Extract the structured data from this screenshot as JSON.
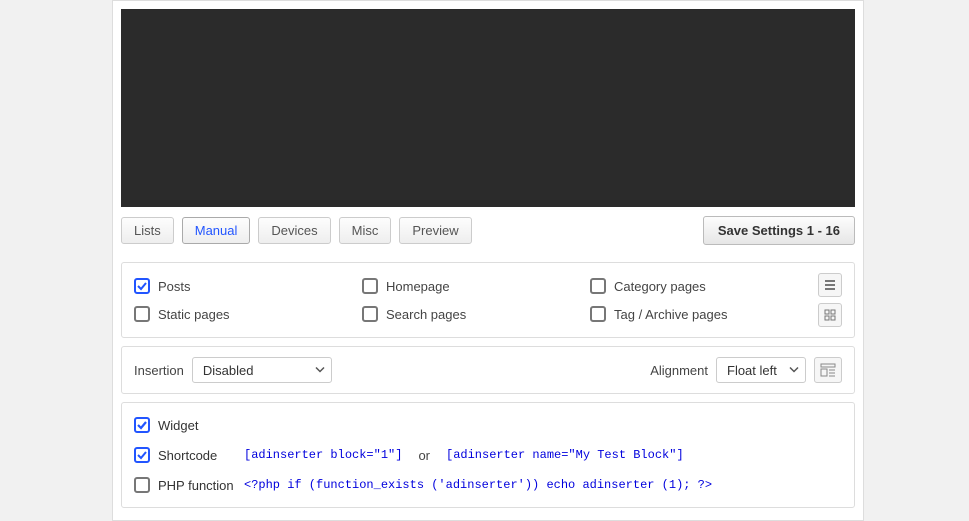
{
  "tabs": {
    "lists": "Lists",
    "manual": "Manual",
    "devices": "Devices",
    "misc": "Misc",
    "preview": "Preview"
  },
  "save_button": "Save Settings 1 - 16",
  "checks": {
    "posts": "Posts",
    "homepage": "Homepage",
    "category": "Category pages",
    "static": "Static pages",
    "search": "Search pages",
    "tag": "Tag / Archive pages"
  },
  "insertion": {
    "label": "Insertion",
    "value": "Disabled"
  },
  "alignment": {
    "label": "Alignment",
    "value": "Float left"
  },
  "manual": {
    "widget": "Widget",
    "shortcode": "Shortcode",
    "shortcode_code1": "[adinserter block=\"1\"]",
    "or": "or",
    "shortcode_code2": "[adinserter name=\"My Test Block\"]",
    "php": "PHP function",
    "php_code": "<?php if (function_exists ('adinserter')) echo adinserter (1); ?>"
  }
}
